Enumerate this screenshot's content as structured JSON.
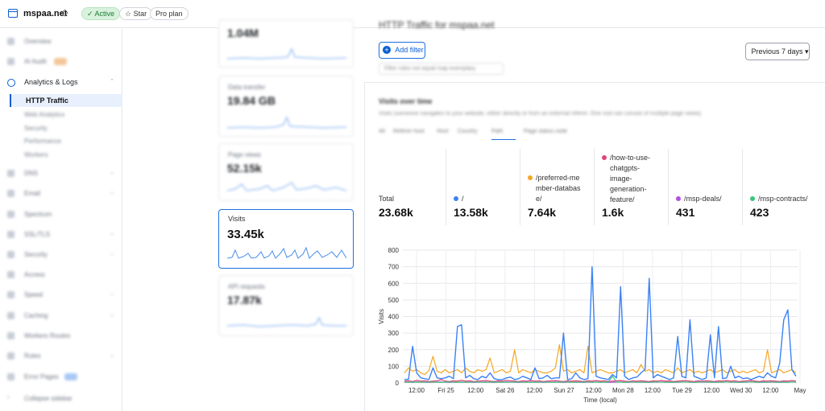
{
  "topbar": {
    "site_name": "mspaa.net",
    "switch_glyph": "◇",
    "active_label": "Active",
    "star_label": "Star",
    "plan_label": "Pro plan"
  },
  "sidebar": {
    "items": [
      {
        "label": "Overview",
        "icon": "home-icon"
      },
      {
        "label": "AI Audit",
        "icon": "ai-icon",
        "badge": "beta"
      },
      {
        "label": "Analytics & Logs",
        "icon": "analytics-icon"
      },
      {
        "label": "DNS",
        "icon": "dns-icon"
      },
      {
        "label": "Email",
        "icon": "email-icon"
      },
      {
        "label": "Spectrum",
        "icon": "spectrum-icon"
      },
      {
        "label": "SSL/TLS",
        "icon": "lock-icon"
      },
      {
        "label": "Security",
        "icon": "shield-icon"
      },
      {
        "label": "Access",
        "icon": "access-icon"
      },
      {
        "label": "Speed",
        "icon": "speed-icon"
      },
      {
        "label": "Caching",
        "icon": "cache-icon"
      },
      {
        "label": "Workers Routes",
        "icon": "workers-icon"
      },
      {
        "label": "Rules",
        "icon": "rules-icon"
      },
      {
        "label": "Error Pages",
        "icon": "error-icon",
        "badge": "new"
      }
    ],
    "active_sub": "HTTP Traffic",
    "subs": [
      "Web Analytics",
      "Security",
      "Performance",
      "Workers"
    ],
    "collapse_label": "Collapse sidebar"
  },
  "cards": [
    {
      "label": "",
      "value": "1.04M"
    },
    {
      "label": "Data transfer",
      "value": "19.84 GB"
    },
    {
      "label": "Page views",
      "value": "52.15k"
    },
    {
      "label": "Visits",
      "value": "33.45k"
    },
    {
      "label": "API requests",
      "value": "17.87k"
    }
  ],
  "main": {
    "title": "HTTP Traffic for mspaa.net",
    "add_filter": "Add filter",
    "filter_chip": "Filter rules not equal map exemplary",
    "range_label": "Previous 7 days",
    "section_title": "Visits over time",
    "section_desc": "Visits (someone navigates to your website, either directly or from an external referer. One visit can consist of multiple page views)",
    "tabs": [
      "All",
      "Referer host",
      "Host",
      "Country",
      "Path",
      "Page status code"
    ]
  },
  "stats": [
    {
      "label": "Total",
      "value": "23.68k",
      "color": ""
    },
    {
      "label": "/",
      "value": "13.58k",
      "color": "#3b82f6"
    },
    {
      "label": "/preferred-member-database/",
      "value": "7.64k",
      "color": "#f5a623"
    },
    {
      "label": "/how-to-use-chatgpts-image-generation-feature/",
      "value": "1.6k",
      "color": "#e0457b"
    },
    {
      "label": "/msp-deals/",
      "value": "431",
      "color": "#b44fe0"
    },
    {
      "label": "/msp-contracts/",
      "value": "423",
      "color": "#3cc47c"
    }
  ],
  "chart_data": {
    "type": "line",
    "ylabel": "Visits",
    "xlabel": "Time (local)",
    "ylim": [
      0,
      800
    ],
    "yticks": [
      0,
      100,
      200,
      300,
      400,
      500,
      600,
      700,
      800
    ],
    "xticks": [
      "12:00",
      "Fri 25",
      "12:00",
      "Sat 26",
      "12:00",
      "Sun 27",
      "12:00",
      "Mon 28",
      "12:00",
      "Tue 29",
      "12:00",
      "Wed 30",
      "12:00",
      "May"
    ],
    "grid": true,
    "series": [
      {
        "name": "/",
        "color": "#3b82f6",
        "values": [
          20,
          22,
          220,
          60,
          30,
          25,
          20,
          90,
          30,
          25,
          30,
          40,
          25,
          340,
          350,
          30,
          45,
          25,
          20,
          40,
          30,
          60,
          25,
          20,
          20,
          30,
          35,
          20,
          25,
          40,
          30,
          20,
          90,
          25,
          30,
          45,
          25,
          30,
          30,
          300,
          20,
          25,
          60,
          30,
          20,
          25,
          700,
          40,
          30,
          25,
          20,
          50,
          30,
          580,
          40,
          20,
          30,
          35,
          60,
          80,
          630,
          30,
          50,
          40,
          30,
          20,
          30,
          280,
          40,
          30,
          380,
          40,
          30,
          20,
          30,
          290,
          30,
          340,
          25,
          30,
          100,
          30,
          40,
          25,
          30,
          20,
          30,
          40,
          30,
          60,
          40,
          30,
          120,
          380,
          440,
          80,
          40
        ]
      },
      {
        "name": "/preferred-member-database/",
        "color": "#f5a623",
        "values": [
          60,
          90,
          70,
          80,
          60,
          50,
          75,
          160,
          70,
          60,
          80,
          60,
          70,
          80,
          60,
          90,
          70,
          60,
          80,
          70,
          80,
          150,
          60,
          70,
          80,
          60,
          70,
          200,
          60,
          80,
          70,
          60,
          80,
          70,
          60,
          60,
          70,
          90,
          230,
          70,
          80,
          60,
          70,
          80,
          60,
          220,
          60,
          70,
          80,
          70,
          60,
          60,
          70,
          80,
          60,
          70,
          80,
          60,
          110,
          70,
          80,
          60,
          70,
          60,
          80,
          70,
          60,
          90,
          60,
          70,
          80,
          60,
          70,
          60,
          70,
          80,
          60,
          70,
          80,
          60,
          70,
          80,
          60,
          70,
          60,
          70,
          80,
          60,
          70,
          200,
          60,
          70,
          80,
          60,
          70,
          80,
          60
        ]
      },
      {
        "name": "/how-to-use-chatgpts-image-generation-feature/",
        "color": "#e0457b",
        "values": [
          10,
          12,
          8,
          15,
          10,
          12,
          8,
          10,
          12,
          20,
          10,
          8,
          12,
          10,
          15,
          10,
          12,
          8,
          10,
          12,
          14,
          10,
          8,
          12,
          10,
          15,
          12,
          10,
          8,
          12,
          10,
          14,
          10,
          12,
          8,
          10,
          12,
          14,
          10,
          8,
          12,
          10,
          12,
          10,
          8,
          12,
          10,
          14,
          10,
          12,
          8,
          10,
          12,
          14,
          10,
          8,
          12,
          10,
          12,
          10,
          8,
          12,
          10,
          14,
          10,
          12,
          8,
          10,
          12,
          14,
          10,
          8,
          12,
          10,
          12,
          10,
          8,
          12,
          10,
          14,
          10,
          12,
          8,
          10,
          12,
          14,
          10,
          8,
          12,
          10,
          12,
          10,
          8,
          12,
          10,
          14,
          10
        ]
      },
      {
        "name": "/msp-deals/",
        "color": "#b44fe0",
        "values": [
          4,
          5,
          3,
          6,
          4,
          5,
          3,
          4,
          5,
          6,
          4,
          3,
          5,
          4,
          6,
          4,
          5,
          3,
          4,
          5,
          6,
          4,
          3,
          5,
          4,
          6,
          5,
          4,
          3,
          5,
          4,
          6,
          4,
          5,
          3,
          4,
          5,
          6,
          4,
          3,
          5,
          4,
          5,
          4,
          3,
          5,
          4,
          6,
          4,
          5,
          3,
          4,
          5,
          6,
          4,
          3,
          5,
          4,
          5,
          4,
          3,
          5,
          4,
          6,
          4,
          5,
          3,
          4,
          5,
          6,
          4,
          3,
          5,
          4,
          5,
          4,
          3,
          5,
          4,
          6,
          4,
          5,
          3,
          4,
          5,
          6,
          4,
          3,
          5,
          4,
          5,
          4,
          3,
          5,
          4,
          6,
          4
        ]
      },
      {
        "name": "/msp-contracts/",
        "color": "#3cc47c",
        "values": [
          5,
          4,
          6,
          3,
          5,
          4,
          6,
          5,
          4,
          3,
          5,
          6,
          4,
          5,
          3,
          5,
          4,
          6,
          5,
          4,
          3,
          5,
          6,
          4,
          5,
          3,
          4,
          5,
          6,
          4,
          5,
          3,
          5,
          4,
          6,
          5,
          4,
          3,
          5,
          6,
          4,
          5,
          3,
          4,
          5,
          6,
          4,
          5,
          3,
          5,
          4,
          40,
          5,
          4,
          3,
          5,
          6,
          4,
          5,
          3,
          4,
          5,
          6,
          4,
          5,
          3,
          5,
          4,
          6,
          5,
          4,
          3,
          5,
          6,
          4,
          5,
          3,
          4,
          5,
          6,
          4,
          5,
          3,
          5,
          4,
          6,
          5,
          4,
          3,
          5,
          6,
          4,
          5,
          3,
          4,
          5,
          6
        ]
      }
    ]
  }
}
